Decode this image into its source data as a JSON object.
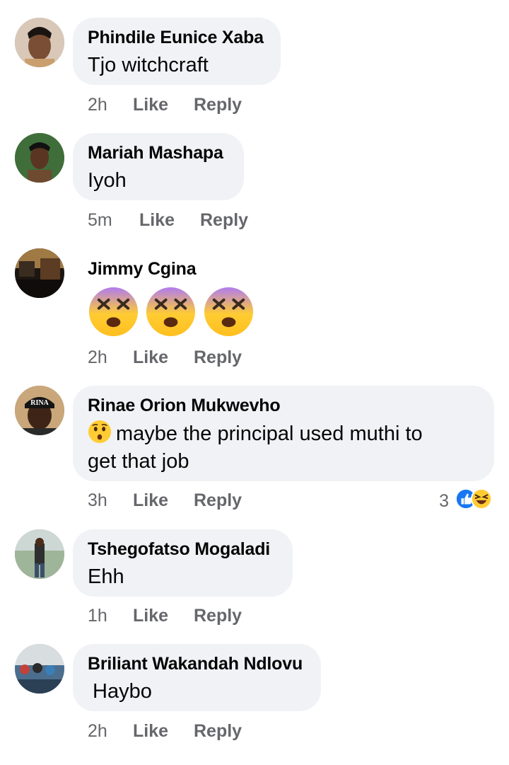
{
  "comments": [
    {
      "name": "Phindile Eunice Xaba",
      "text": "Tjo witchcraft",
      "time": "2h",
      "like": "Like",
      "reply": "Reply"
    },
    {
      "name": "Mariah Mashapa",
      "text": "Iyoh",
      "time": "5m",
      "like": "Like",
      "reply": "Reply"
    },
    {
      "name": "Jimmy Cgina",
      "emojis": [
        "dizzy-face",
        "dizzy-face",
        "dizzy-face"
      ],
      "time": "2h",
      "like": "Like",
      "reply": "Reply"
    },
    {
      "name": "Rinae Orion Mukwevho",
      "text_line1": "maybe the principal used muthi to",
      "text_line2": "get that job",
      "leading_emoji": "hushed-face",
      "time": "3h",
      "like": "Like",
      "reply": "Reply",
      "reactions": {
        "count": "3",
        "types": [
          "like",
          "haha"
        ]
      },
      "avatar_cap_text": "RINA"
    },
    {
      "name": "Tshegofatso Mogaladi",
      "text": "Ehh",
      "time": "1h",
      "like": "Like",
      "reply": "Reply"
    },
    {
      "name": "Briliant Wakandah Ndlovu",
      "text": "Haybo",
      "time": "2h",
      "like": "Like",
      "reply": "Reply"
    }
  ],
  "colors": {
    "bubble": "#f0f2f5",
    "meta": "#65676b",
    "text": "#050505",
    "like_blue": "#1877f2",
    "emoji_yellow": "#ffcc33"
  }
}
